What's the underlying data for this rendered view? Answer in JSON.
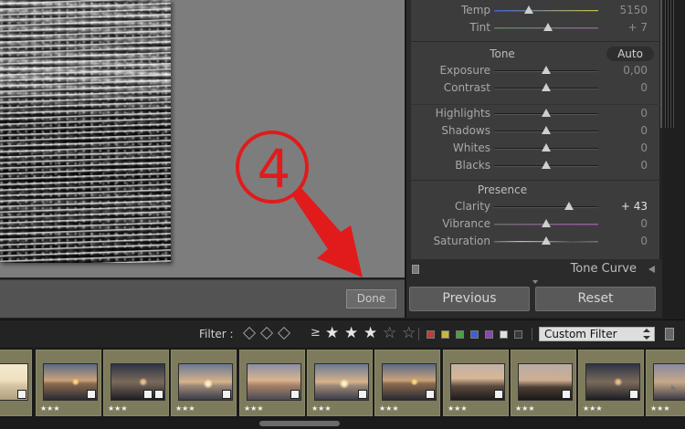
{
  "preview": {
    "annotation_number": "4",
    "done_label": "Done"
  },
  "panel": {
    "rows_wb": [
      {
        "label": "Temp",
        "value": "5150",
        "pos": 0.33
      },
      {
        "label": "Tint",
        "value": "+ 7",
        "pos": 0.52
      }
    ],
    "tone": {
      "title": "Tone",
      "auto_label": "Auto",
      "rows": [
        {
          "label": "Exposure",
          "value": "0,00",
          "pos": 0.5
        },
        {
          "label": "Contrast",
          "value": "0",
          "pos": 0.5
        }
      ],
      "rows2": [
        {
          "label": "Highlights",
          "value": "0",
          "pos": 0.5
        },
        {
          "label": "Shadows",
          "value": "0",
          "pos": 0.5
        },
        {
          "label": "Whites",
          "value": "0",
          "pos": 0.5
        },
        {
          "label": "Blacks",
          "value": "0",
          "pos": 0.5
        }
      ]
    },
    "presence": {
      "title": "Presence",
      "rows": [
        {
          "label": "Clarity",
          "value": "+ 43",
          "pos": 0.715,
          "strong": true
        },
        {
          "label": "Vibrance",
          "value": "0",
          "pos": 0.5
        },
        {
          "label": "Saturation",
          "value": "0",
          "pos": 0.5
        }
      ]
    },
    "tone_curve_label": "Tone Curve",
    "previous_label": "Previous",
    "reset_label": "Reset"
  },
  "filter": {
    "label": "Filter :",
    "ge_symbol": "≥",
    "stars_filled": 3,
    "stars_total": 5,
    "custom_filter": "Custom Filter",
    "color_labels": [
      "#c23a3a",
      "#c9b73a",
      "#4aa043",
      "#3f5fd0",
      "#8a45b6",
      "#e0e0e0",
      "#3a3a3a"
    ]
  },
  "filmstrip": {
    "frames": [
      {
        "stars": "",
        "scene": "bright"
      },
      {
        "stars": "★★★",
        "scene": "sunset"
      },
      {
        "stars": "★★★",
        "scene": "dark"
      },
      {
        "stars": "★★★",
        "scene": "sunset2"
      },
      {
        "stars": "★★★",
        "scene": "sunset3"
      },
      {
        "stars": "★★★",
        "scene": "sunset2"
      },
      {
        "stars": "★★★",
        "scene": "sunset"
      },
      {
        "stars": "★★★",
        "scene": "rocks"
      },
      {
        "stars": "★★★",
        "scene": "rocks2"
      },
      {
        "stars": "★★★",
        "scene": "dark"
      },
      {
        "stars": "★★★",
        "scene": "partial"
      }
    ]
  }
}
